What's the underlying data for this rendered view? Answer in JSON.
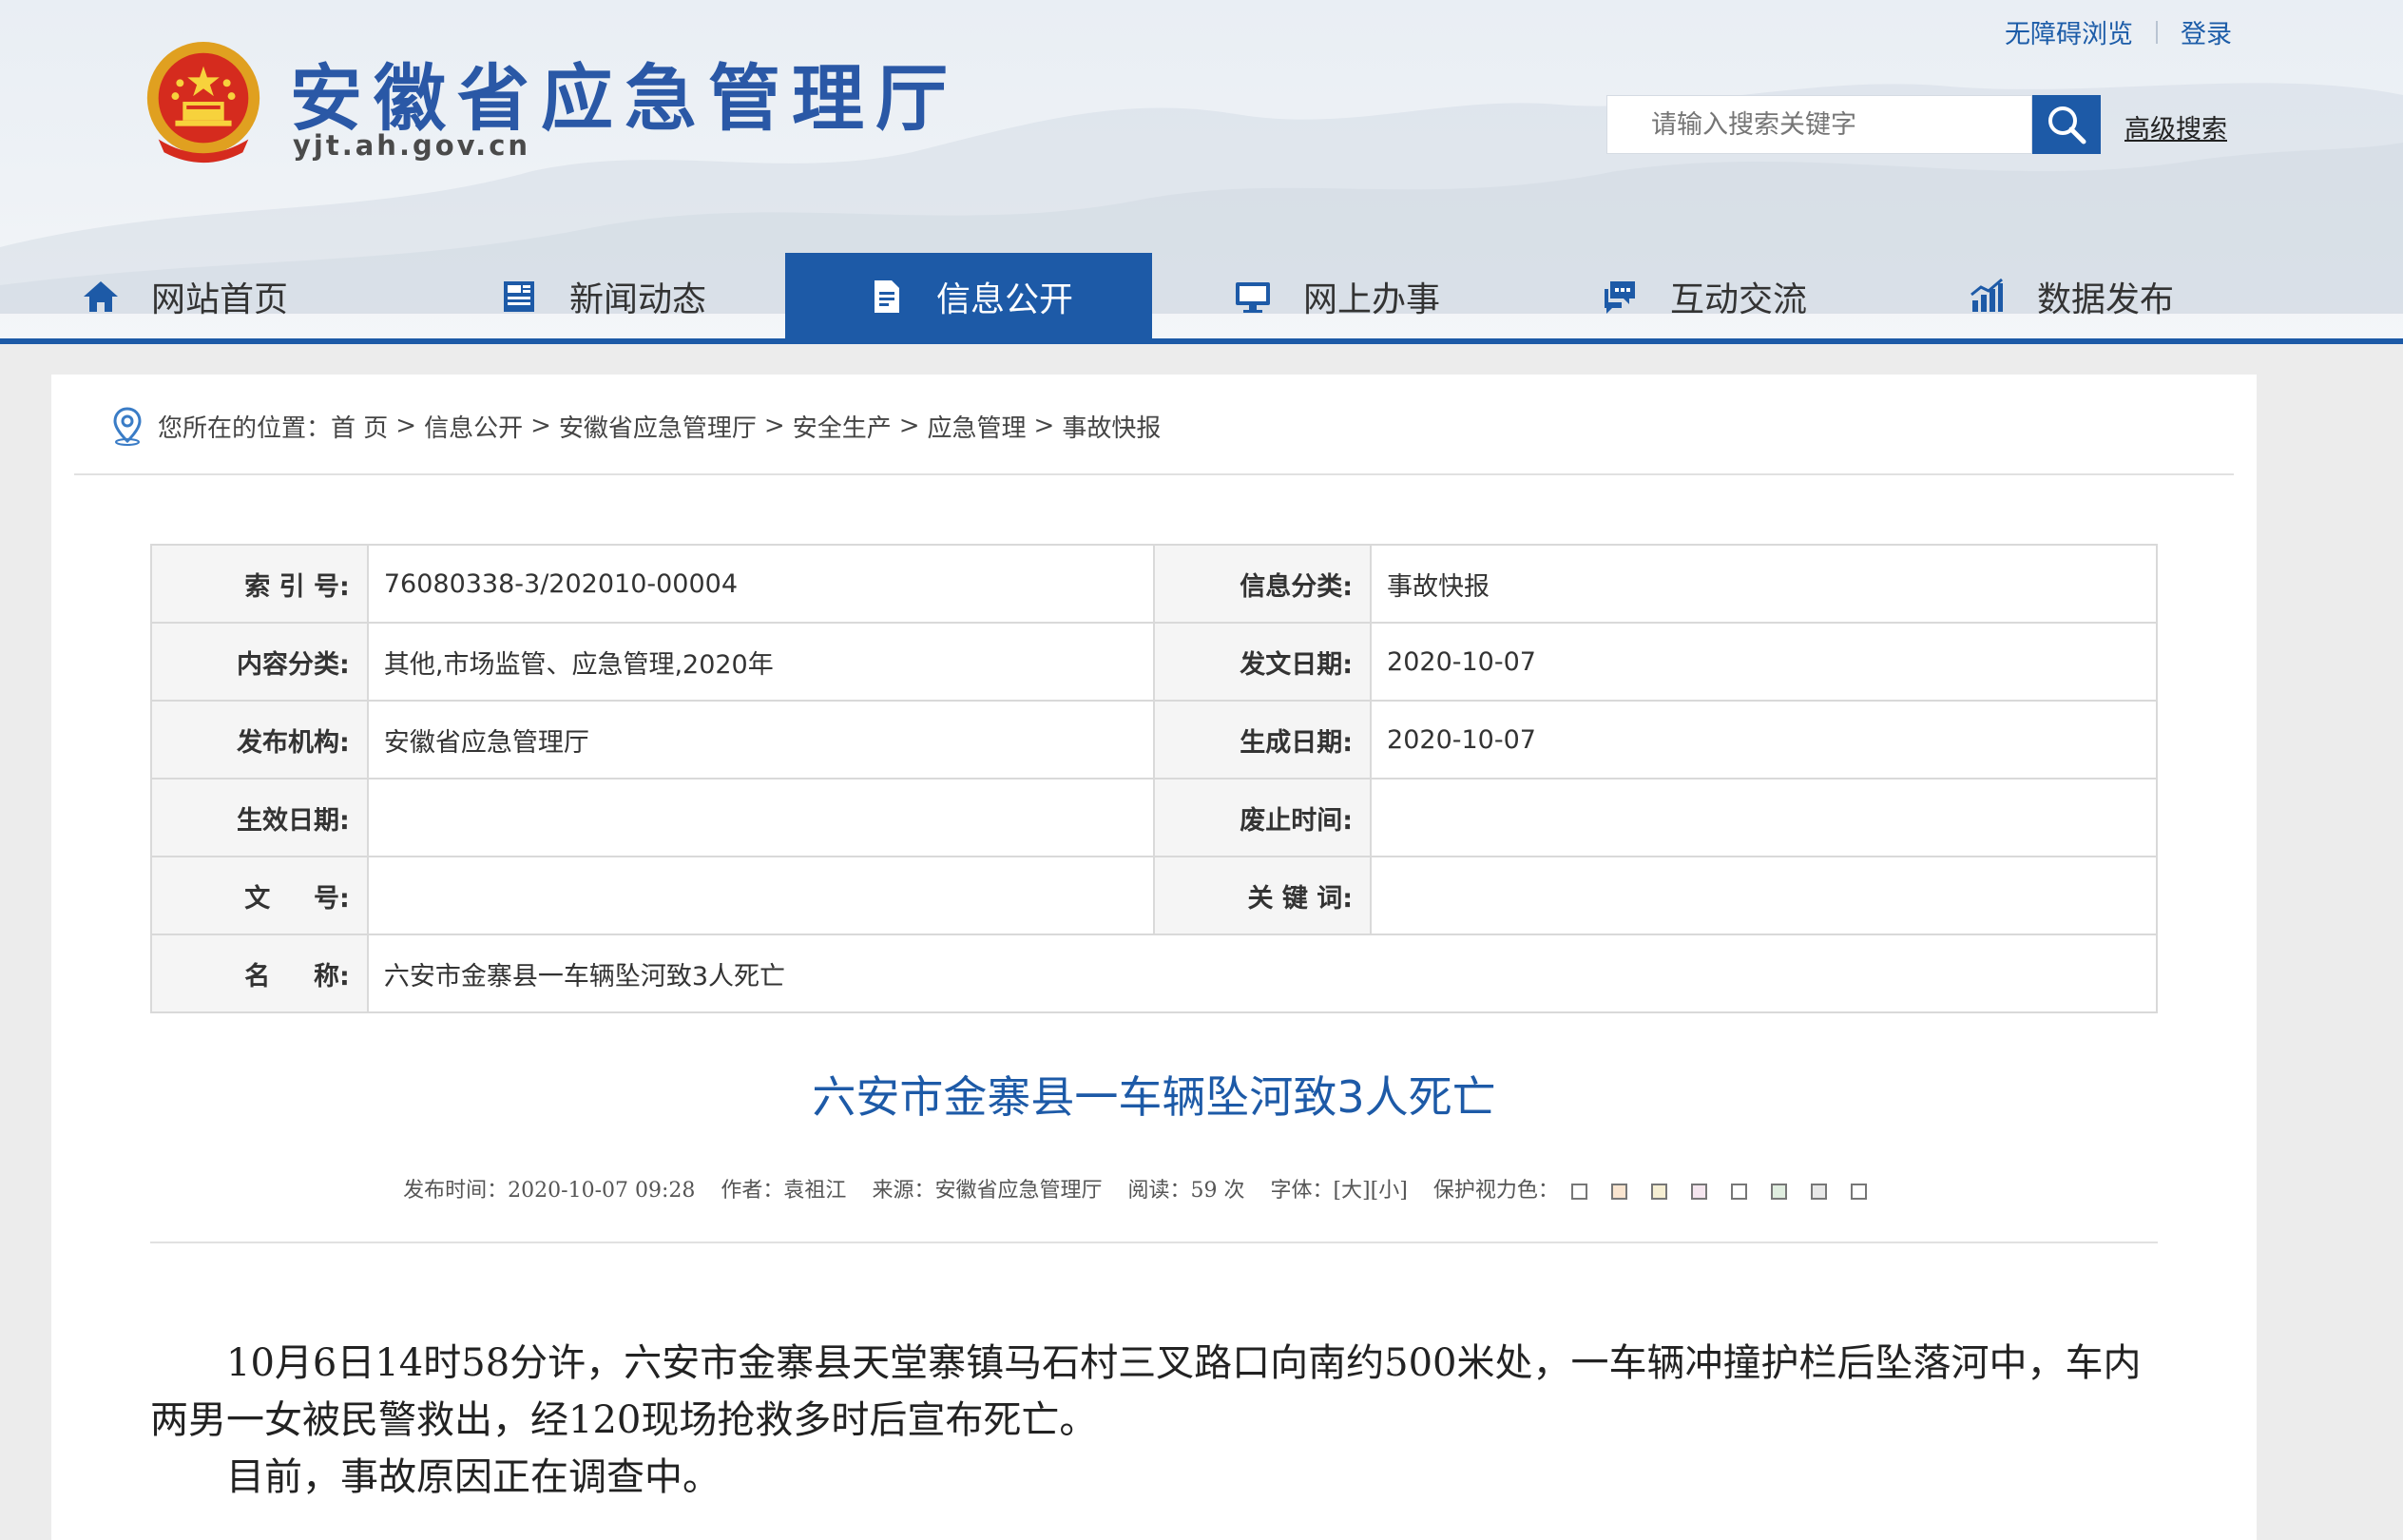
{
  "header": {
    "top_links": [
      "无障碍浏览",
      "登录"
    ],
    "site_title": "安徽省应急管理厅",
    "site_domain": "yjt.ah.gov.cn",
    "search": {
      "placeholder": "请输入搜索关键字",
      "advanced_label": "高级搜索"
    }
  },
  "nav": {
    "items": [
      {
        "label": "网站首页",
        "icon": "home-icon"
      },
      {
        "label": "新闻动态",
        "icon": "news-icon"
      },
      {
        "label": "信息公开",
        "icon": "document-icon",
        "active": true
      },
      {
        "label": "网上办事",
        "icon": "monitor-icon"
      },
      {
        "label": "互动交流",
        "icon": "chat-icon"
      },
      {
        "label": "数据发布",
        "icon": "chart-icon"
      }
    ]
  },
  "breadcrumb": {
    "prefix": "您所在的位置：",
    "items": [
      "首 页",
      "信息公开",
      "安徽省应急管理厅",
      "安全生产",
      "应急管理",
      "事故快报"
    ],
    "separator": ">"
  },
  "meta_table": {
    "rows": [
      {
        "l1": "索 引 号:",
        "v1": "76080338-3/202010-00004",
        "l2": "信息分类:",
        "v2": "事故快报"
      },
      {
        "l1": "内容分类:",
        "v1": "其他,市场监管、应急管理,2020年",
        "l2": "发文日期:",
        "v2": "2020-10-07"
      },
      {
        "l1": "发布机构:",
        "v1": "安徽省应急管理厅",
        "l2": "生成日期:",
        "v2": "2020-10-07"
      },
      {
        "l1": "生效日期:",
        "v1": "",
        "l2": "废止时间:",
        "v2": ""
      },
      {
        "l1": "文 　 号:",
        "v1": "",
        "l2": "关 键 词:",
        "v2": ""
      },
      {
        "l1": "名 　 称:",
        "v1": "六安市金寨县一车辆坠河致3人死亡"
      }
    ]
  },
  "article": {
    "title": "六安市金寨县一车辆坠河致3人死亡",
    "meta": {
      "publish_time": "发布时间：2020-10-07 09:28",
      "author": "作者：袁祖江",
      "source": "来源：安徽省应急管理厅",
      "views": "阅读：59 次",
      "font_label": "字体：",
      "font_large": "[大]",
      "font_small": "[小]",
      "eye_care_label": "保护视力色："
    },
    "swatch_colors": [
      "#ffffff",
      "#fae5d0",
      "#f6efd3",
      "#f5e6ef",
      "#ffffff",
      "#e0eee0",
      "#e8e8e8",
      "#ffffff"
    ],
    "paragraphs": [
      "10月6日14时58分许，六安市金寨县天堂寨镇马石村三叉路口向南约500米处，一车辆冲撞护栏后坠落河中，车内两男一女被民警救出，经120现场抢救多时后宣布死亡。",
      "目前，事故原因正在调查中。"
    ]
  }
}
